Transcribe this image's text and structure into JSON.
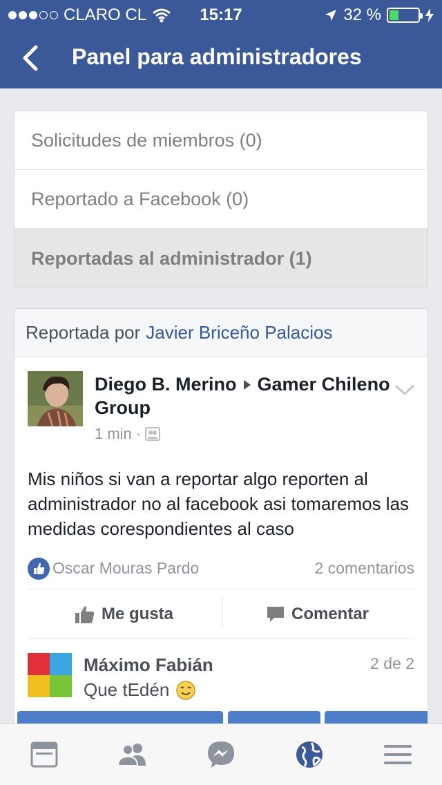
{
  "status_bar": {
    "carrier": "CLARO CL",
    "time": "15:17",
    "battery": "32 %",
    "battery_level": 0.32
  },
  "navbar": {
    "title": "Panel para administradores"
  },
  "admin_menu": {
    "items": [
      {
        "label": "Solicitudes de miembros (0)"
      },
      {
        "label": "Reportado a Facebook (0)"
      },
      {
        "label": "Reportadas al administrador (1)"
      }
    ]
  },
  "report": {
    "reported_by_label": "Reportada por",
    "reporter_name": "Javier Briceño Palacios",
    "post": {
      "author": "Diego B. Merino",
      "group": "Gamer Chileno Group",
      "time": "1 min ·",
      "text": "Mis niños si van a reportar algo reporten al administrador no al facebook asi tomaremos las medidas corespondientes al caso",
      "reactor": "Oscar Mouras Pardo",
      "comments_count": "2 comentarios",
      "like_label": "Me gusta",
      "comment_label": "Comentar"
    },
    "comment": {
      "author": "Máximo Fabián",
      "text": "Que tEdén",
      "position": "2 de 2"
    }
  },
  "tabbar": {
    "tabs": [
      "news-feed",
      "friends",
      "messenger",
      "notifications",
      "menu"
    ]
  },
  "colors": {
    "brand": "#3b5998",
    "link": "#365899",
    "like_blue": "#4267b2"
  }
}
